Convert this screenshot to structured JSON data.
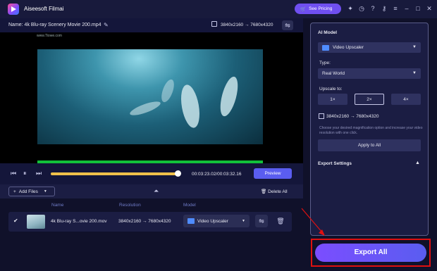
{
  "app": {
    "title": "Aiseesoft Filmai"
  },
  "titlebar": {
    "pricing_label": "See Pricing",
    "icons": [
      "cart-icon",
      "gift-icon",
      "history-icon",
      "help-icon",
      "key-icon",
      "menu-icon",
      "minimize-icon",
      "maximize-icon",
      "close-icon"
    ]
  },
  "file": {
    "name_text": "Name:  4k Blu-ray Scenery Movie 200.mp4",
    "resolution_text": "3840x2160  →  7680x4320"
  },
  "preview": {
    "watermark": "www.Tiowe.com"
  },
  "player": {
    "time": "00:03:23.02/00:03:32.16",
    "preview_label": "Preview",
    "progress": 0.975
  },
  "filebar": {
    "add_files_label": "Add Files",
    "delete_all_label": "Delete All"
  },
  "table": {
    "headers": {
      "name": "Name",
      "resolution": "Resolution",
      "model": "Model"
    },
    "rows": [
      {
        "name": "4k Blu-ray S...ovie 200.mov",
        "resolution": "3840x2160  →  7680x4320",
        "model": "Video Upscaler"
      }
    ]
  },
  "panel": {
    "ai_model_label": "AI Model",
    "model_value": "Video Upscaler",
    "type_label": "Type:",
    "type_value": "Real World",
    "upscale_label": "Upscale to:",
    "scales": [
      "1×",
      "2×",
      "4×"
    ],
    "active_scale": "2×",
    "resolution_text": "3840x2160  →  7680x4320",
    "hint": "Choose your desired magnification option and increase your video resolution with one click.",
    "apply_label": "Apply to All",
    "export_settings_label": "Export Settings"
  },
  "export": {
    "label": "Export All"
  },
  "colors": {
    "accent": "#5a5df0",
    "highlight_box": "#e01010",
    "progress": "#f0c04a",
    "frame_bar": "#12c03a"
  }
}
